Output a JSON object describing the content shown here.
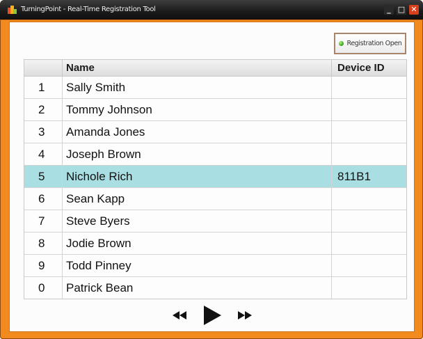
{
  "window": {
    "title": "TurningPoint - Real-Time Registration Tool",
    "controls": {
      "minimize": "_",
      "maximize": "□",
      "close": "✕"
    }
  },
  "registration_button": {
    "label": "Registration Open",
    "status_icon": "green-status-led",
    "status_color": "#3fa81c"
  },
  "table": {
    "columns": [
      "",
      "Name",
      "Device ID"
    ],
    "rows": [
      {
        "num": "1",
        "name": "Sally Smith",
        "device_id": ""
      },
      {
        "num": "2",
        "name": "Tommy Johnson",
        "device_id": ""
      },
      {
        "num": "3",
        "name": "Amanda Jones",
        "device_id": ""
      },
      {
        "num": "4",
        "name": "Joseph Brown",
        "device_id": ""
      },
      {
        "num": "5",
        "name": "Nichole Rich",
        "device_id": "811B1"
      },
      {
        "num": "6",
        "name": "Sean Kapp",
        "device_id": ""
      },
      {
        "num": "7",
        "name": "Steve Byers",
        "device_id": ""
      },
      {
        "num": "8",
        "name": "Jodie Brown",
        "device_id": ""
      },
      {
        "num": "9",
        "name": "Todd Pinney",
        "device_id": ""
      },
      {
        "num": "0",
        "name": "Patrick Bean",
        "device_id": ""
      }
    ],
    "selected_row": 4
  },
  "playback": {
    "rewind_icon": "rewind-icon",
    "play_icon": "play-icon",
    "fast_forward_icon": "fast-forward-icon"
  },
  "colors": {
    "accent_frame": "#f28a1e",
    "selected_row": "#a9dfe3"
  }
}
